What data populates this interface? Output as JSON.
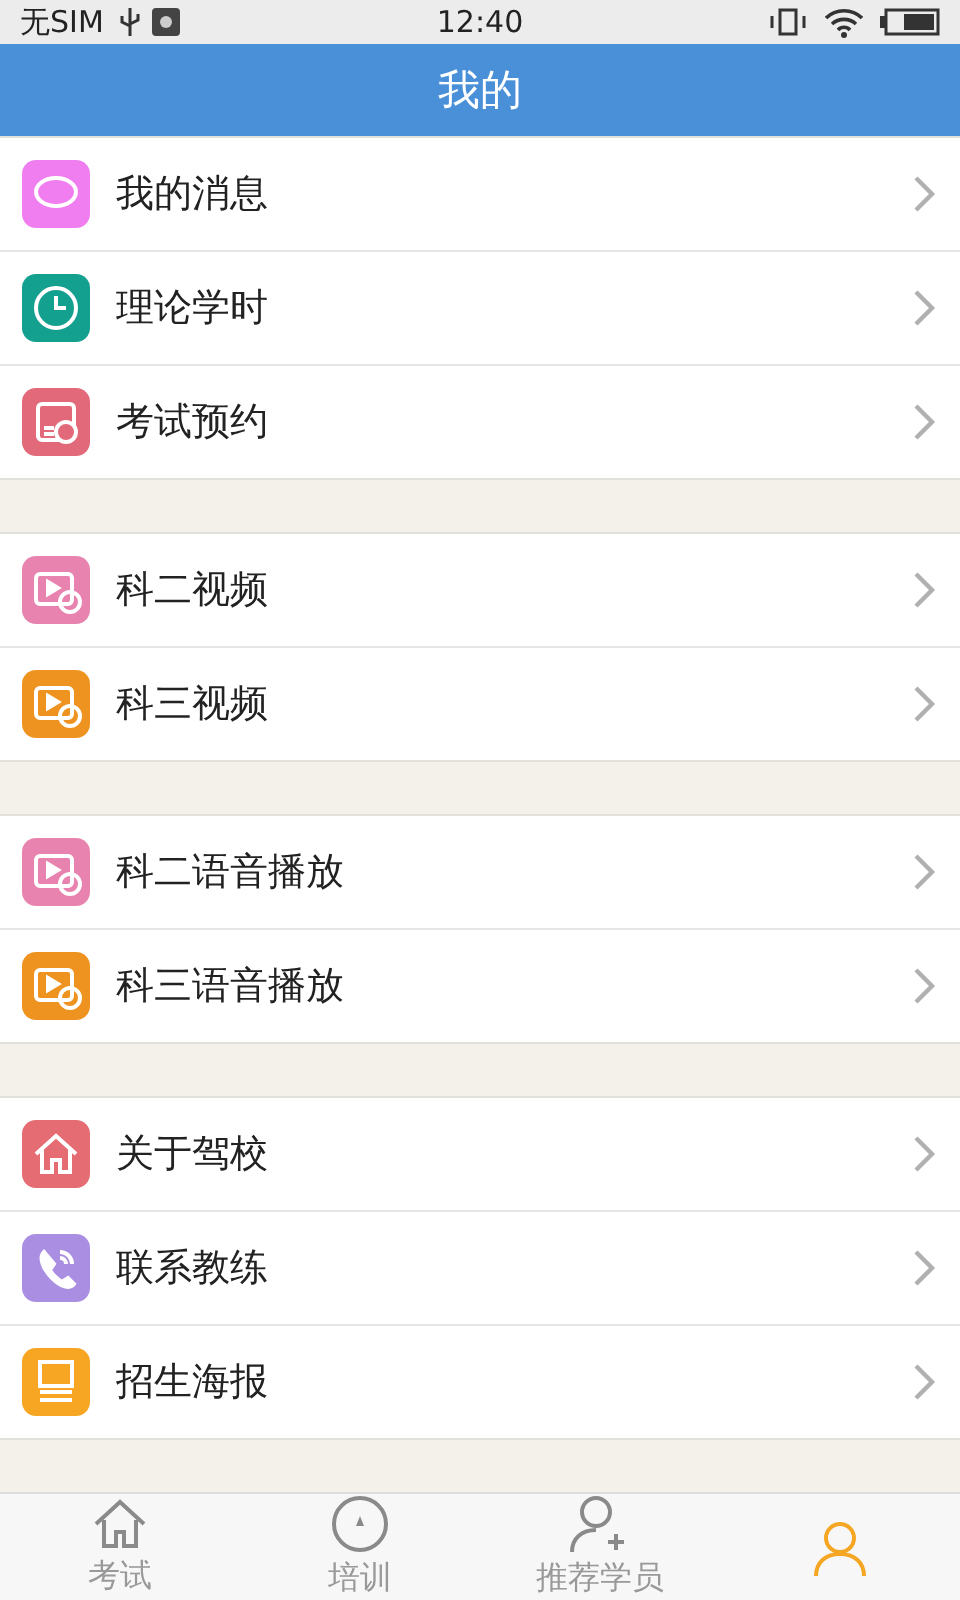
{
  "status_bar": {
    "carrier": "无SIM",
    "time": "12:40"
  },
  "header": {
    "title": "我的"
  },
  "groups": [
    {
      "items": [
        {
          "label": "我的消息",
          "kind": "message",
          "color": "#f07ef0"
        },
        {
          "label": "理论学时",
          "kind": "clock",
          "color": "#14a08e"
        },
        {
          "label": "考试预约",
          "kind": "exam",
          "color": "#e2697a"
        }
      ]
    },
    {
      "items": [
        {
          "label": "科二视频",
          "kind": "video",
          "color": "#e882ae"
        },
        {
          "label": "科三视频",
          "kind": "video",
          "color": "#ef9320"
        }
      ]
    },
    {
      "items": [
        {
          "label": "科二语音播放",
          "kind": "video",
          "color": "#e882ae"
        },
        {
          "label": "科三语音播放",
          "kind": "video",
          "color": "#ef9320"
        }
      ]
    },
    {
      "items": [
        {
          "label": "关于驾校",
          "kind": "home",
          "color": "#e56c72"
        },
        {
          "label": "联系教练",
          "kind": "phone",
          "color": "#a98ee2"
        },
        {
          "label": "招生海报",
          "kind": "poster",
          "color": "#f6a623"
        }
      ]
    }
  ],
  "tabs": [
    {
      "label": "考试",
      "kind": "home",
      "selected": false
    },
    {
      "label": "培训",
      "kind": "compass",
      "selected": false
    },
    {
      "label": "推荐学员",
      "kind": "person-add",
      "selected": false
    },
    {
      "kind": "person",
      "selected": true
    }
  ]
}
